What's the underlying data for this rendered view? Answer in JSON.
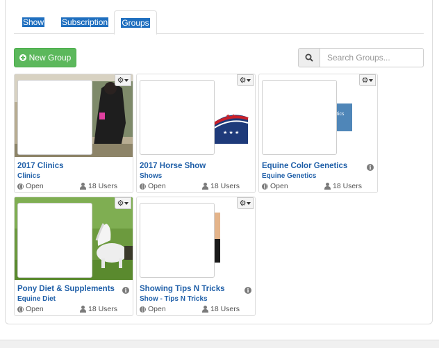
{
  "tabs": [
    {
      "label": "Show"
    },
    {
      "label": "Subscription"
    },
    {
      "label": "Groups",
      "active": true
    }
  ],
  "toolbar": {
    "new_group_label": "New Group",
    "search_placeholder": "Search Groups..."
  },
  "icons": {
    "new_group": "plus-circle-icon",
    "search": "search-icon",
    "gear": "gear-icon",
    "status": "globe-icon",
    "users": "user-icon",
    "info": "info-icon"
  },
  "colors": {
    "accent": "#1f5fa8",
    "success": "#5cb85c",
    "tab_highlight": "#1f6fbf"
  },
  "groups": [
    {
      "title": "2017 Clinics",
      "subtitle": "Clinics",
      "status": "Open",
      "users": "18 Users",
      "has_info": false
    },
    {
      "title": "2017 Horse Show",
      "subtitle": "Shows",
      "status": "Open",
      "users": "18 Users",
      "has_info": false
    },
    {
      "title": "Equine Color Genetics",
      "subtitle": "Equine Genetics",
      "status": "Open",
      "users": "18 Users",
      "has_info": true,
      "image_text": "etics"
    },
    {
      "title": "Pony Diet & Supplements",
      "subtitle": "Equine Diet",
      "status": "Open",
      "users": "18 Users",
      "has_info": true
    },
    {
      "title": "Showing Tips N Tricks",
      "subtitle": "Show - Tips N Tricks",
      "status": "Open",
      "users": "18 Users",
      "has_info": true
    }
  ]
}
